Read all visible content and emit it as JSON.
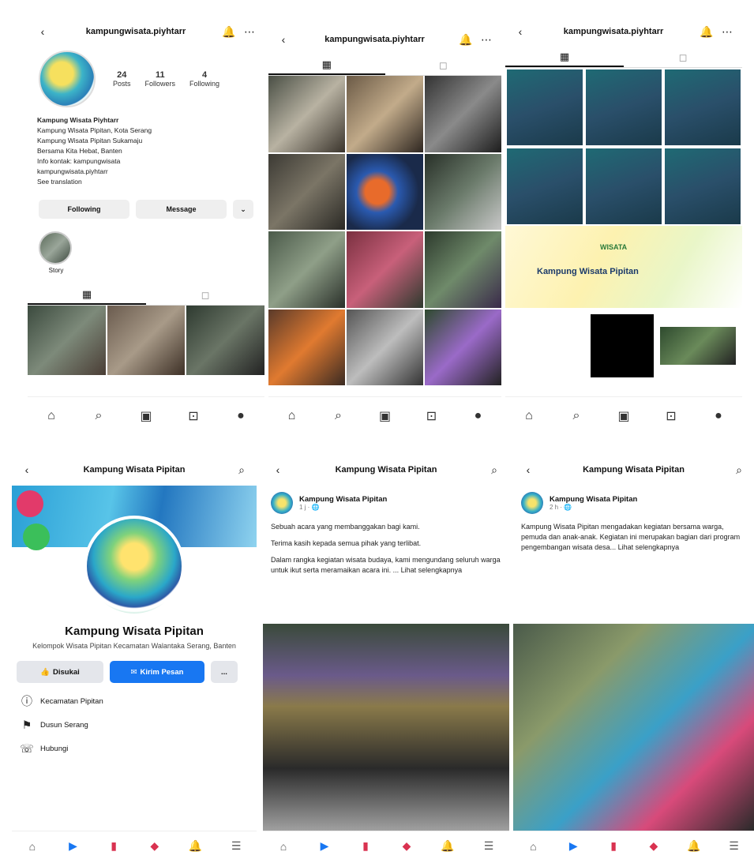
{
  "instagram": {
    "username": "kampungwisata.piyhtarr",
    "profile": {
      "stats": [
        {
          "value": "24",
          "label": "Posts"
        },
        {
          "value": "11",
          "label": "Followers"
        },
        {
          "value": "4",
          "label": "Following"
        }
      ],
      "bio_lines": [
        "Kampung Wisata Piyhtarr",
        "Kampung Wisata Pipitan, Kota Serang",
        "Kampung Wisata Pipitan Sukamaju",
        "Bersama Kita Hebat, Banten",
        "Info kontak: kampungwisata",
        "kampungwisata.piyhtarr",
        "See translation"
      ],
      "buttons": {
        "follow": "Following",
        "message": "Message",
        "more": "⌄"
      },
      "highlight_label": "Story"
    },
    "nav_icons": [
      "home-icon",
      "search-icon",
      "reels-icon",
      "shop-icon",
      "profile-icon"
    ]
  },
  "facebook": {
    "page_name": "Kampung Wisata Pipitan",
    "page_description": "Kelompok Wisata Pipitan Kecamatan Walantaka Serang, Banten",
    "buttons": {
      "like": "Disukai",
      "message": "Kirim Pesan",
      "more": "..."
    },
    "info_rows": [
      {
        "icon": "info-icon",
        "text": "Kecamatan Pipitan"
      },
      {
        "icon": "location-icon",
        "text": "Dusun Serang"
      },
      {
        "icon": "phone-icon",
        "text": "Hubungi"
      }
    ],
    "posts": [
      {
        "author": "Kampung Wisata Pipitan",
        "time": "1 j · 🌐",
        "paragraphs": [
          "Sebuah acara yang membanggakan bagi kami.",
          "Terima kasih kepada semua pihak yang terlibat.",
          "Dalam rangka kegiatan wisata budaya, kami mengundang seluruh warga untuk ikut serta meramaikan acara ini. ... Lihat selengkapnya"
        ]
      },
      {
        "author": "Kampung Wisata Pipitan",
        "time": "2 h · 🌐",
        "paragraphs": [
          "Kampung Wisata Pipitan mengadakan kegiatan bersama warga, pemuda dan anak-anak. Kegiatan ini merupakan bagian dari program pengembangan wisata desa... Lihat selengkapnya"
        ]
      }
    ],
    "nav_icons": [
      "home-icon",
      "video-icon",
      "marketplace-icon",
      "notifications-icon",
      "bell-icon",
      "menu-icon"
    ]
  },
  "ig3_banner": {
    "title": "Kampung Wisata Pipitan",
    "badge": "WISATA"
  }
}
